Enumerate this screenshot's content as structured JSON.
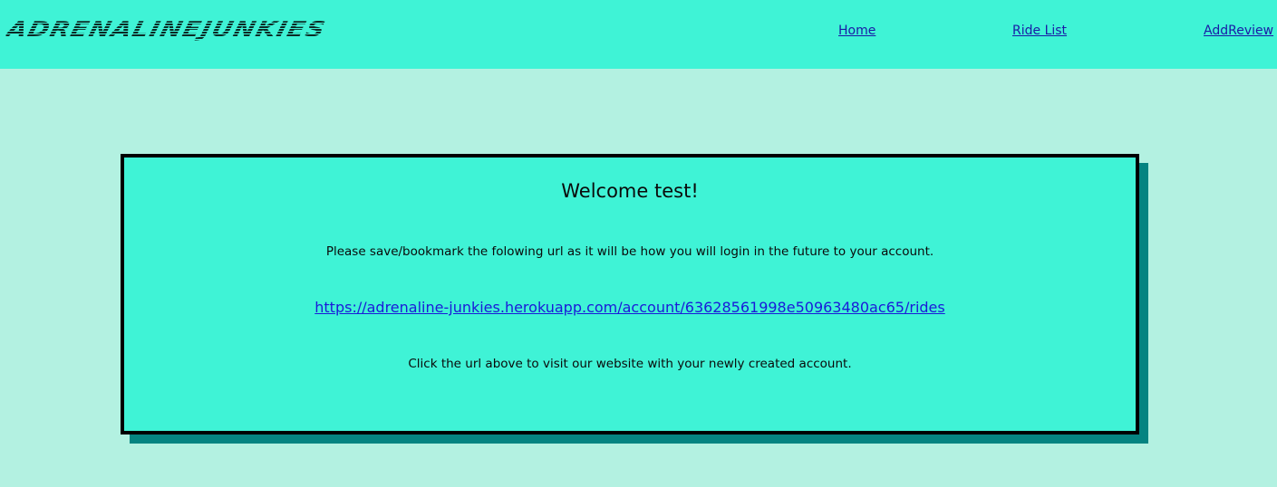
{
  "navbar": {
    "logo_text": "AdrenalineJunkies",
    "links": [
      {
        "label": "Home"
      },
      {
        "label": "Ride List"
      },
      {
        "label": "AddReview"
      }
    ]
  },
  "card": {
    "title": "Welcome test!",
    "instructions": "Please save/bookmark the folowing url as it will be how you will login in the future to your account.",
    "account_url": "https://adrenaline-junkies.herokuapp.com/account/63628561998e50963480ac65/rides",
    "click_note": "Click the url above to visit our website with your newly created account."
  },
  "colors": {
    "page_background": "#b3f1e1",
    "navbar_background": "#3ff3d6",
    "card_background": "#3ff3d6",
    "card_shadow": "#058481",
    "card_border": "#000000",
    "link": "#1a1ad9"
  }
}
